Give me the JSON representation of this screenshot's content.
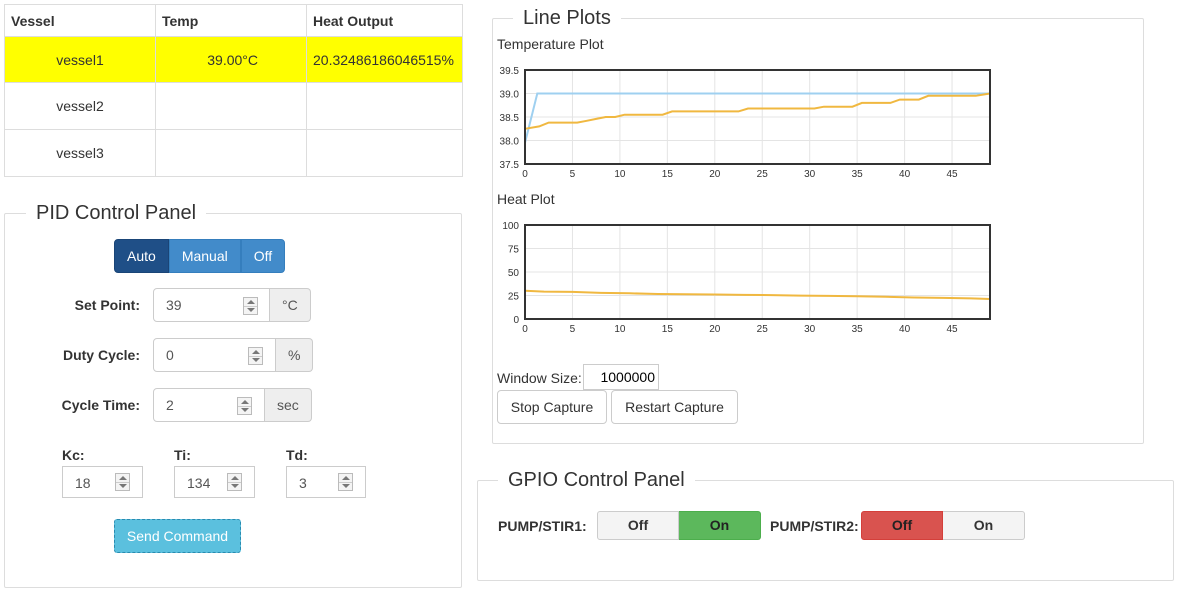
{
  "vessel_table": {
    "headers": [
      "Vessel",
      "Temp",
      "Heat Output"
    ],
    "rows": [
      {
        "vessel": "vessel1",
        "temp": "39.00°C",
        "heat": "20.32486186046515%"
      },
      {
        "vessel": "vessel2",
        "temp": "",
        "heat": ""
      },
      {
        "vessel": "vessel3",
        "temp": "",
        "heat": ""
      }
    ],
    "highlight_color": "#ffff00"
  },
  "pid_panel": {
    "title": "PID Control Panel",
    "modes": [
      {
        "label": "Auto",
        "active": true
      },
      {
        "label": "Manual",
        "active": false
      },
      {
        "label": "Off",
        "active": false
      }
    ],
    "set_point": {
      "label": "Set Point:",
      "value": "39",
      "unit": "°C"
    },
    "duty_cycle": {
      "label": "Duty Cycle:",
      "value": "0",
      "unit": "%"
    },
    "cycle_time": {
      "label": "Cycle Time:",
      "value": "2",
      "unit": "sec"
    },
    "kc": {
      "label": "Kc:",
      "value": "18"
    },
    "ti": {
      "label": "Ti:",
      "value": "134"
    },
    "td": {
      "label": "Td:",
      "value": "3"
    },
    "send_label": "Send Command"
  },
  "line_plots": {
    "title": "Line Plots",
    "window_size_label": "Window Size:",
    "window_size_value": "1000000",
    "stop_label": "Stop Capture",
    "restart_label": "Restart Capture"
  },
  "chart_data": [
    {
      "type": "line",
      "title": "Temperature Plot",
      "xlim": [
        0,
        49
      ],
      "ylim": [
        37.5,
        39.5
      ],
      "x_ticks": [
        0,
        5,
        10,
        15,
        20,
        25,
        30,
        35,
        40,
        45
      ],
      "y_ticks": [
        37.5,
        38.0,
        38.5,
        39.0,
        39.5
      ],
      "y_tick_labels": [
        "37.5",
        "38.0",
        "38.5",
        "39.0",
        "39.5"
      ],
      "grid": true,
      "series": [
        {
          "color": "#9fd0f0",
          "x": [
            0,
            1.3,
            49
          ],
          "y": [
            37.95,
            39.0,
            39.0
          ]
        },
        {
          "color": "#f0b840",
          "x": [
            0,
            1.5,
            2.5,
            5.5,
            6.5,
            7.5,
            8.5,
            9.5,
            10.5,
            11.5,
            14.5,
            15.5,
            22.5,
            23.5,
            30.5,
            31.5,
            34.5,
            35.5,
            38.5,
            39.5,
            41.5,
            42.5,
            47.5,
            49
          ],
          "y": [
            38.25,
            38.3,
            38.38,
            38.38,
            38.42,
            38.46,
            38.5,
            38.5,
            38.55,
            38.55,
            38.55,
            38.62,
            38.62,
            38.68,
            38.68,
            38.72,
            38.72,
            38.8,
            38.8,
            38.87,
            38.87,
            38.95,
            38.95,
            39.0
          ]
        }
      ]
    },
    {
      "type": "line",
      "title": "Heat Plot",
      "xlim": [
        0,
        49
      ],
      "ylim": [
        0,
        100
      ],
      "x_ticks": [
        0,
        5,
        10,
        15,
        20,
        25,
        30,
        35,
        40,
        45
      ],
      "y_ticks": [
        0,
        25,
        50,
        75,
        100
      ],
      "y_tick_labels": [
        "0",
        "25",
        "50",
        "75",
        "100"
      ],
      "grid": true,
      "series": [
        {
          "color": "#f0b840",
          "x": [
            0,
            2,
            5,
            8,
            11,
            14,
            17,
            20,
            23,
            26,
            29,
            32,
            35,
            38,
            41,
            44,
            47,
            49
          ],
          "y": [
            30,
            29.2,
            28.8,
            27.8,
            27.3,
            26.6,
            26.3,
            26.1,
            25.6,
            25.4,
            24.9,
            24.6,
            24.1,
            23.6,
            22.9,
            22.4,
            21.9,
            21.3
          ]
        }
      ]
    }
  ],
  "gpio_panel": {
    "title": "GPIO Control Panel",
    "pumps": [
      {
        "label": "PUMP/STIR1:",
        "off_label": "Off",
        "on_label": "On",
        "state": "on"
      },
      {
        "label": "PUMP/STIR2:",
        "off_label": "Off",
        "on_label": "On",
        "state": "off"
      }
    ],
    "on_color": "#5cb85c",
    "off_color": "#d9534f"
  }
}
